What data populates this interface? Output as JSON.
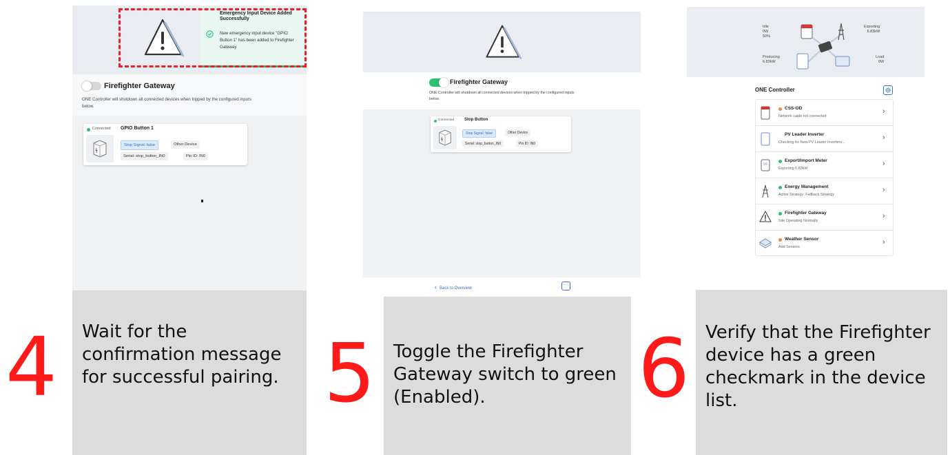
{
  "step4": {
    "number": "4",
    "caption": "Wait for the confirmation message for successful pairing.",
    "toast": {
      "title": "Emergency Input Device Added Successfully",
      "message": "New emergency input device \"GPIO Button 1\" has been added to Firefighter Gateway"
    },
    "gateway_title": "Firefighter Gateway",
    "gateway_desc": "ONE Controller will shutdown all connected devices when tripped by the configured inputs below.",
    "toggle_on": false,
    "device": {
      "status": "Connected",
      "name": "GPIO Button 1",
      "signal": "Stop Signal: false",
      "type": "Other Device",
      "serial": "Serial: stop_button_IN0",
      "pin": "Pin ID: IN0"
    }
  },
  "step5": {
    "number": "5",
    "caption": "Toggle the Firefighter Gateway switch to green (Enabled).",
    "gateway_title": "Firefighter Gateway",
    "gateway_desc": "ONE Controller will shutdown all connected devices when tripped by the configured inputs below.",
    "toggle_on": true,
    "device": {
      "status": "Connected",
      "name": "Stop Button",
      "signal": "Stop Signal: false",
      "type": "Other Device",
      "serial": "Serial: stop_button_IN0",
      "pin": "Pin ID: IN0"
    },
    "back_link": "Back to Overview"
  },
  "step6": {
    "number": "6",
    "caption": "Verify that the Firefighter device has a green checkmark in the device list.",
    "stats": {
      "idle_label": "Idle",
      "idle_value": "0W",
      "idle_pct": "50%",
      "exporting_label": "Exporting",
      "exporting_value": "6.83kW",
      "producing_label": "Producing",
      "producing_value": "6.83kW",
      "load_label": "Load",
      "load_value": "0W"
    },
    "controller_title": "ONE Controller",
    "devices": [
      {
        "name": "CSS-OD",
        "sub": "Network cable not connected",
        "status": "orange",
        "icon": "battery-cabinet-icon"
      },
      {
        "name": "PV Leader Inverter",
        "sub": "Checking for New PV Leader Inverters...",
        "status": "none",
        "icon": "inverter-icon"
      },
      {
        "name": "Export/Import Meter",
        "sub": "Exporting 6.83kW",
        "status": "green",
        "icon": "meter-icon"
      },
      {
        "name": "Energy Management",
        "sub": "Active Strategy: Fallback Strategy",
        "status": "green",
        "icon": "power-tower-icon"
      },
      {
        "name": "Firefighter Gateway",
        "sub": "Site Operating Normally",
        "status": "green",
        "icon": "warning-triangle-icon"
      },
      {
        "name": "Weather Sensor",
        "sub": "Add Sensors",
        "status": "orange",
        "icon": "weather-sensor-icon"
      }
    ],
    "colors": {
      "green": "#2fbf71",
      "orange": "#f08a3c"
    }
  },
  "colors": {
    "accent_red": "#ff1a1a",
    "toggle_green": "#2fbf71",
    "toast_teal": "#e9f7f2",
    "dashed_red": "#e8202a"
  }
}
